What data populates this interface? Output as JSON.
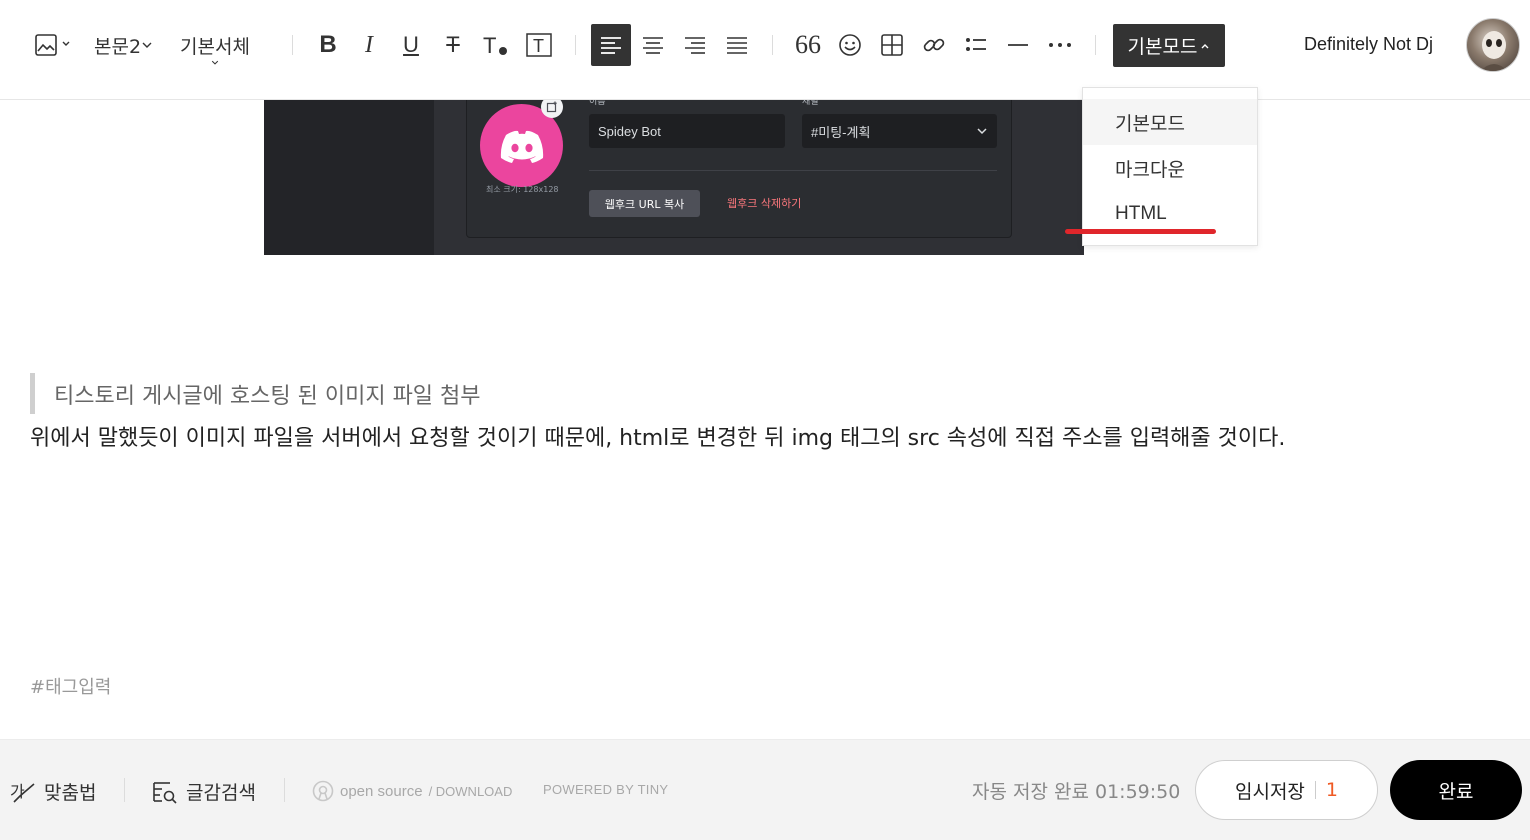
{
  "toolbar": {
    "paragraph_style": "본문2",
    "font_family": "기본서체",
    "mode_label": "기본모드",
    "user_name": "Definitely Not Dj"
  },
  "mode_menu": {
    "items": [
      {
        "label": "기본모드",
        "selected": true
      },
      {
        "label": "마크다운",
        "selected": false
      },
      {
        "label": "HTML",
        "selected": false
      }
    ]
  },
  "embedded_image": {
    "field_name_label": "이름",
    "field_channel_label": "채널",
    "bot_name": "Spidey Bot",
    "channel": "#미팅-계획",
    "min_size": "최소 크기: 128x128",
    "copy_url_button": "웹후크 URL 복사",
    "delete_link": "웹후크 삭제하기"
  },
  "content": {
    "quote": "티스토리 게시글에 호스팅 된 이미지 파일 첨부",
    "paragraph": "위에서 말했듯이 이미지 파일을 서버에서 요청할 것이기 때문에, html로 변경한 뒤 img 태그의 src 속성에 직접 주소를 입력해줄 것이다.",
    "tag_placeholder": "#태그입력"
  },
  "footer": {
    "spellcheck": "맞춤법",
    "search": "글감검색",
    "open_source": "open source",
    "download": "/ DOWNLOAD",
    "powered_by": "POWERED BY TINY",
    "autosave": "자동 저장 완료 01:59:50",
    "draft_label": "임시저장",
    "draft_count": "1",
    "done_label": "완료"
  },
  "colors": {
    "accent_dark": "#333333",
    "highlight_red": "#e0262b",
    "draft_count": "#ef5a24",
    "discord_pink": "#eb459e"
  }
}
